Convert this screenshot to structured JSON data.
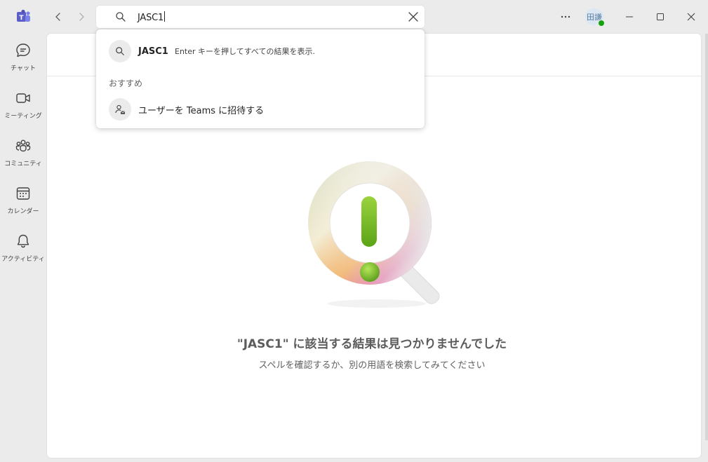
{
  "titlebar": {
    "search_value": "JASC1",
    "avatar_initials": "田謙",
    "presence_color": "#13a10e"
  },
  "rail": {
    "items": [
      {
        "label": "チャット",
        "icon": "chat-icon"
      },
      {
        "label": "ミーティング",
        "icon": "video-icon"
      },
      {
        "label": "コミュニティ",
        "icon": "people-community-icon"
      },
      {
        "label": "カレンダー",
        "icon": "calendar-icon"
      },
      {
        "label": "アクティビティ",
        "icon": "bell-icon"
      }
    ]
  },
  "dropdown": {
    "query_text": "JASC1",
    "query_hint": "Enter キーを押してすべての結果を表示.",
    "section_label": "おすすめ",
    "invite_label": "ユーザーを Teams に招待する"
  },
  "empty_state": {
    "title": "\"JASC1\" に該当する結果は見つかりませんでした",
    "subtitle": "スペルを確認するか、別の用語を検索してみてください"
  },
  "colors": {
    "brand": "#5b5fc7",
    "background": "#ebebeb",
    "panel": "#ffffff"
  }
}
